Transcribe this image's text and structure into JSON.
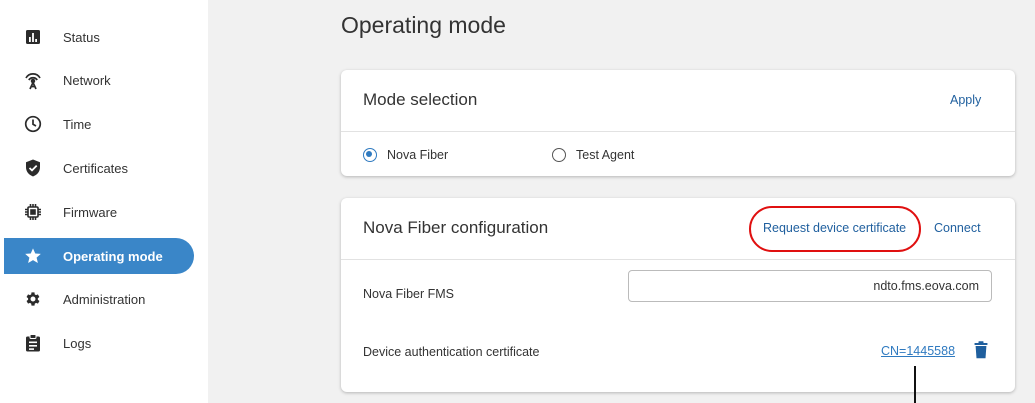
{
  "sidebar": {
    "items": [
      {
        "label": "Status",
        "icon": "bar-chart-icon"
      },
      {
        "label": "Network",
        "icon": "antenna-icon"
      },
      {
        "label": "Time",
        "icon": "clock-icon"
      },
      {
        "label": "Certificates",
        "icon": "shield-check-icon"
      },
      {
        "label": "Firmware",
        "icon": "chip-icon"
      },
      {
        "label": "Operating mode",
        "icon": "star-icon",
        "active": true
      },
      {
        "label": "Administration",
        "icon": "gear-icon"
      },
      {
        "label": "Logs",
        "icon": "clipboard-icon"
      }
    ],
    "active_color": "#3a86c8"
  },
  "main": {
    "title": "Operating mode",
    "mode_card": {
      "title": "Mode selection",
      "apply_label": "Apply",
      "options": [
        {
          "label": "Nova Fiber",
          "selected": true
        },
        {
          "label": "Test Agent",
          "selected": false
        }
      ]
    },
    "config_card": {
      "title": "Nova Fiber configuration",
      "request_cert_label": "Request device certificate",
      "connect_label": "Connect",
      "fms_label": "Nova Fiber FMS",
      "fms_value": "ndto.fms.eova.com",
      "cert_label": "Device authentication certificate",
      "cert_value": "CN=1445588",
      "delete_icon": "trash-icon"
    }
  },
  "colors": {
    "link": "#1f5f9e",
    "radio_selected": "#2f7ac0",
    "annotation": "#e01010"
  }
}
